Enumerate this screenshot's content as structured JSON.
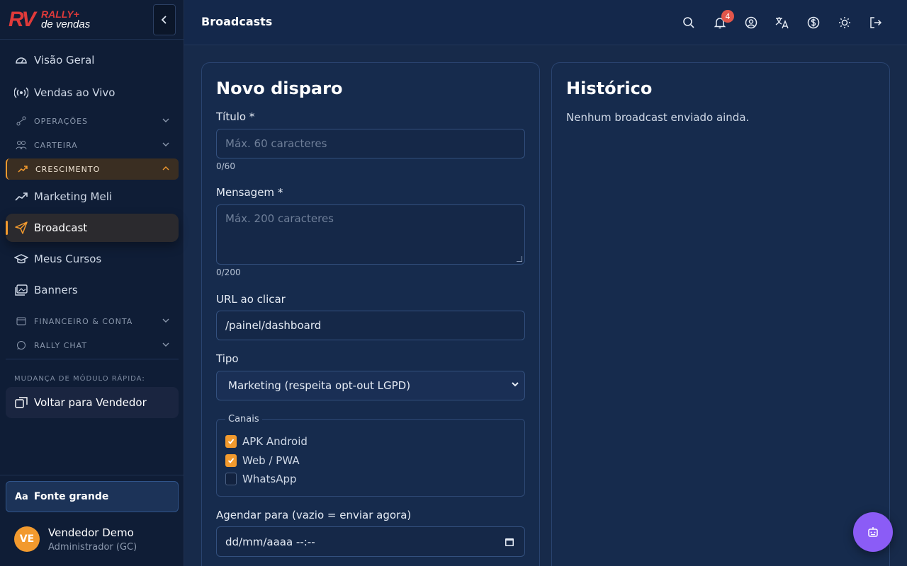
{
  "brand": {
    "logo_mark": "RV",
    "logo_name": "RALLY+",
    "logo_sub": "de vendas"
  },
  "sidebar": {
    "items": [
      {
        "label": "Visão Geral",
        "icon": "gauge-icon"
      },
      {
        "label": "Vendas ao Vivo",
        "icon": "broadcast-signal-icon"
      },
      {
        "label": "OPERAÇÕES",
        "icon": "route-icon",
        "section": true
      },
      {
        "label": "CARTEIRA",
        "icon": "users-icon",
        "section": true
      },
      {
        "label": "CRESCIMENTO",
        "icon": "trending-up-icon",
        "section": true,
        "open": true
      },
      {
        "label": "Marketing Meli",
        "icon": "trending-up-icon"
      },
      {
        "label": "Broadcast",
        "icon": "send-icon",
        "active": true
      },
      {
        "label": "Meus Cursos",
        "icon": "graduation-cap-icon"
      },
      {
        "label": "Banners",
        "icon": "images-icon"
      },
      {
        "label": "FINANCEIRO & CONTA",
        "icon": "wallet-icon",
        "section": true
      },
      {
        "label": "RALLY CHAT",
        "icon": "whatsapp-icon",
        "section": true
      }
    ],
    "quick_switch_label": "MUDANÇA DE MÓDULO RÁPIDA:",
    "switch_button": "Voltar para Vendedor",
    "font_button": "Fonte grande",
    "font_icon": "Aa",
    "user": {
      "initials": "VE",
      "name": "Vendedor Demo",
      "role": "Administrador (GC)"
    }
  },
  "header": {
    "title": "Broadcasts",
    "notification_count": "4",
    "icons": [
      "search-icon",
      "bell-icon",
      "user-circle-icon",
      "translate-icon",
      "dollar-icon",
      "sun-icon",
      "logout-icon"
    ]
  },
  "form": {
    "title": "Novo disparo",
    "titulo_label": "Título *",
    "titulo_placeholder": "Máx. 60 caracteres",
    "titulo_counter": "0/60",
    "mensagem_label": "Mensagem *",
    "mensagem_placeholder": "Máx. 200 caracteres",
    "mensagem_counter": "0/200",
    "url_label": "URL ao clicar",
    "url_value": "/painel/dashboard",
    "tipo_label": "Tipo",
    "tipo_value": "Marketing (respeita opt-out LGPD)",
    "canais_legend": "Canais",
    "canais": [
      {
        "label": "APK Android",
        "checked": true
      },
      {
        "label": "Web / PWA",
        "checked": true
      },
      {
        "label": "WhatsApp",
        "checked": false
      }
    ],
    "agendar_label": "Agendar para (vazio = enviar agora)",
    "agendar_placeholder": "dd/mm/aaaa --:--"
  },
  "history": {
    "title": "Histórico",
    "empty": "Nenhum broadcast enviado ainda."
  },
  "colors": {
    "accent": "#f29a2e",
    "fab": "#8b5cf6",
    "badge": "#e2564b",
    "logo": "#e03a3a"
  }
}
